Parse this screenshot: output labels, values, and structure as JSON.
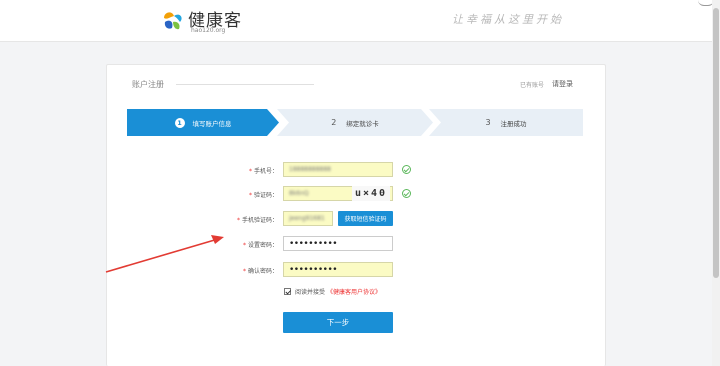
{
  "header": {
    "logo_text": "健康客",
    "logo_sub": "hao120.org",
    "slogan": "让幸福从这里开始"
  },
  "card": {
    "title": "账户注册",
    "login_hint": "已有账号",
    "login_link": "请登录"
  },
  "steps": [
    {
      "num": "1",
      "label": "填写账户信息",
      "active": true
    },
    {
      "num": "2",
      "label": "绑定就诊卡",
      "active": false
    },
    {
      "num": "3",
      "label": "注册成功",
      "active": false
    }
  ],
  "form": {
    "phone_label": "手机号：",
    "phone_value": "18888888888",
    "captcha_label": "验证码：",
    "captcha_value": "8k6nQ",
    "captcha_image_text": "u×40",
    "sms_label": "手机验证码：",
    "sms_value": "jeeng91681",
    "sms_button": "获取短信验证码",
    "password_label": "设置密码：",
    "password_value": "••••••••••",
    "confirm_label": "确认密码：",
    "confirm_value": "••••••••••",
    "agree_text": "阅读并接受",
    "agree_link": "《健康客用户协议》",
    "next_button": "下一步"
  },
  "colors": {
    "accent": "#1a8fd6",
    "input_autofill": "#fbfbc4",
    "required": "#e33333",
    "annotation_arrow": "#e23b33"
  },
  "icons": {
    "valid": "check-circle-icon",
    "logo": "leaf-logo-icon"
  }
}
